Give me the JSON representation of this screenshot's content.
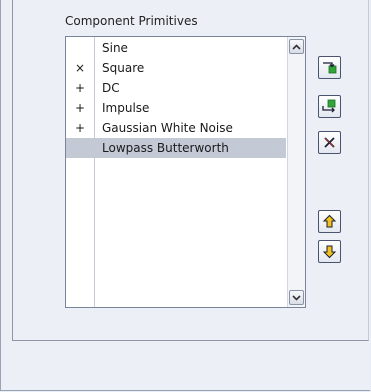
{
  "section": {
    "label": "Component Primitives"
  },
  "list": {
    "items": [
      {
        "mark": "",
        "name": "Sine"
      },
      {
        "mark": "×",
        "name": "Square"
      },
      {
        "mark": "+",
        "name": "DC"
      },
      {
        "mark": "+",
        "name": "Impulse"
      },
      {
        "mark": "+",
        "name": "Gaussian White Noise"
      },
      {
        "mark": "",
        "name": "Lowpass Butterworth"
      }
    ],
    "selected_index": 5
  },
  "colors": {
    "selection": "#c4c9d6",
    "green_accent": "#2fa53a",
    "yellow_accent": "#f2c21b",
    "panel": "#eceff6"
  },
  "icons": {
    "scroll_up": "chevron-up-icon",
    "scroll_down": "chevron-down-icon",
    "add": "add-component-icon",
    "insert": "insert-component-icon",
    "delete": "delete-x-icon",
    "move_up": "arrow-up-icon",
    "move_down": "arrow-down-icon"
  }
}
